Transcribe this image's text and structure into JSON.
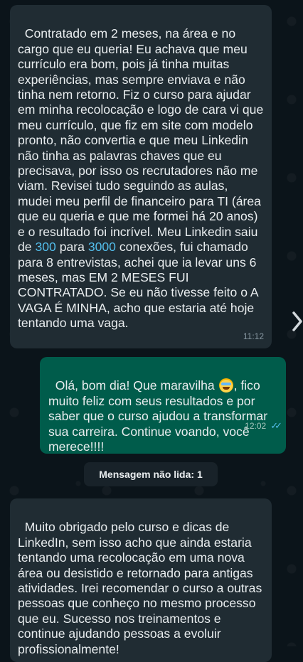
{
  "messages": [
    {
      "side": "incoming",
      "text_before_link1": "Contratado em 2 meses, na área e no cargo que eu queria! Eu achava que meu currículo era bom, pois já tinha muitas experiências, mas sempre enviava e não tinha nem retorno. Fiz o curso para ajudar em minha recolocação e logo de cara vi que meu currículo, que fiz em site com modelo pronto, não convertia e que meu Linkedin não tinha as palavras chaves que eu precisava, por isso os recrutadores não me viam. Revisei tudo seguindo as aulas, mudei meu perfil de financeiro para TI (área que eu queria e que me formei há 20 anos) e o resultado foi incrível. Meu Linkedin saiu de ",
      "link1": "300",
      "text_between": " para ",
      "link2": "3000",
      "text_after": " conexões, fui chamado para 8 entrevistas, achei que ia levar uns 6 meses, mas EM 2 MESES FUI CONTRATADO. Se eu não tivesse feito o A VAGA É MINHA, acho que estaria até hoje tentando uma vaga.",
      "time": "11:12"
    },
    {
      "side": "outgoing",
      "text_before_emoji": "Olá, bom dia! Que maravilha ",
      "emoji": "star-struck-emoji",
      "text_after_emoji": ", fico muito feliz com seus resultados e por saber que o curso ajudou a transformar sua carreira. Continue voando, você merece!!!!",
      "time": "12:02",
      "status": "read"
    },
    {
      "side": "incoming",
      "text": "Muito obrigado pelo curso e dicas de LinkedIn, sem isso acho que ainda estaria tentando uma recolocação em uma nova área ou desistido e retornado para antigas atividades. Irei recomendar o curso a outras pessoas que conheço no mesmo processo que eu. Sucesso nos treinamentos e continue ajudando pessoas a evoluir profissionalmente!"
    }
  ],
  "unread_divider": "Mensagem não lida: 1",
  "icons": {
    "next": "chevron-right-icon",
    "read_status": "double-check-icon"
  },
  "colors": {
    "background": "#0b141a",
    "incoming_bubble": "#202c33",
    "outgoing_bubble": "#005c4b",
    "link": "#53bdeb"
  }
}
